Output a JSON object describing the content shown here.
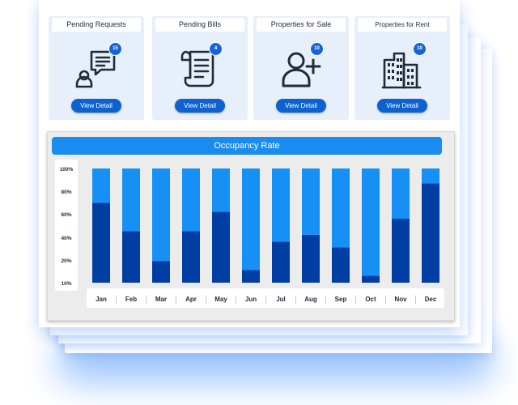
{
  "cards": [
    {
      "title": "Pending Requests",
      "count": "15",
      "button": "View Detail",
      "icon": "chat-request-icon"
    },
    {
      "title": "Pending Bills",
      "count": "4",
      "button": "View Detail",
      "icon": "bill-document-icon"
    },
    {
      "title": "Properties for Sale",
      "count": "10",
      "button": "View Detail",
      "icon": "add-user-icon"
    },
    {
      "title": "Properties for Rent",
      "count": "10",
      "button": "View Detail",
      "icon": "building-icon"
    }
  ],
  "colors": {
    "accent": "#1a8cf0",
    "bar_dark": "#003ea3",
    "bar_light": "#1690f4",
    "button": "#0d62cf"
  },
  "chart_data": {
    "type": "bar",
    "title": "Occupancy Rate",
    "categories": [
      "Jan",
      "Feb",
      "Mar",
      "Apr",
      "May",
      "Jun",
      "Jul",
      "Aug",
      "Sep",
      "Oct",
      "Nov",
      "Dec"
    ],
    "yticks": [
      "100%",
      "80%",
      "60%",
      "40%",
      "20%",
      "10%"
    ],
    "series": [
      {
        "values": [
          70,
          45,
          19,
          45,
          62,
          11,
          36,
          42,
          31,
          6,
          56,
          87
        ]
      },
      {
        "values": [
          30,
          55,
          81,
          55,
          38,
          89,
          64,
          58,
          69,
          94,
          44,
          13
        ]
      }
    ],
    "ylim": [
      0,
      100
    ],
    "stacked": true,
    "grid": false,
    "legend": "none"
  }
}
